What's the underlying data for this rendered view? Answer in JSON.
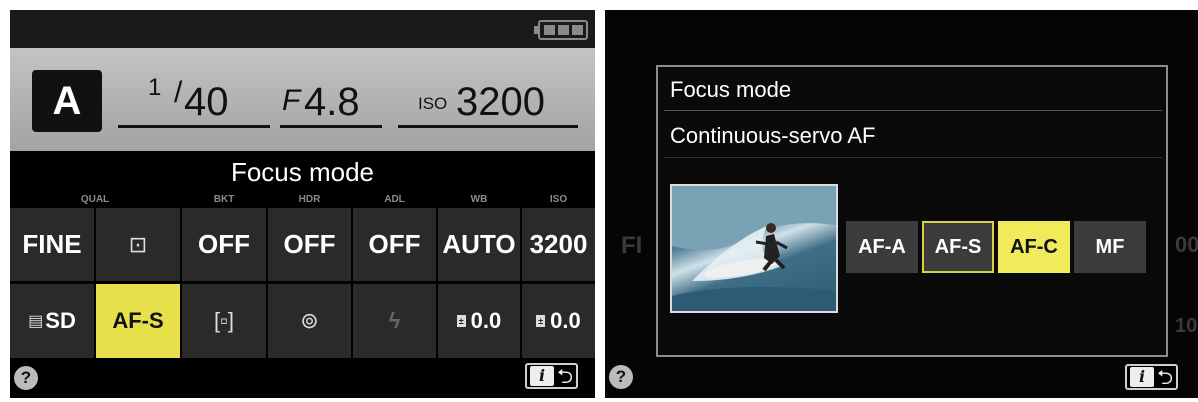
{
  "left_screen": {
    "mode": "A",
    "shutter": {
      "numerator": "1",
      "denominator": "40"
    },
    "aperture": {
      "prefix": "F",
      "value": "4.8"
    },
    "iso": {
      "label": "ISO",
      "value": "3200"
    },
    "title": "Focus mode",
    "column_labels": [
      "QUAL",
      "BKT",
      "HDR",
      "ADL",
      "WB",
      "ISO"
    ],
    "row1": [
      "FINE",
      "OFF",
      "OFF",
      "OFF",
      "AUTO",
      "3200"
    ],
    "row2": {
      "card": "SD",
      "focus_mode": "AF-S",
      "ev1": "0.0",
      "ev2": "0.0"
    },
    "help_label": "?",
    "info_label": "i",
    "active_color": "#e8e04a"
  },
  "right_screen": {
    "dialog_title": "Focus mode",
    "dialog_subtitle": "Continuous-servo AF",
    "options": [
      "AF-A",
      "AF-S",
      "AF-C",
      "MF"
    ],
    "selected_option": "AF-C",
    "highlighted_option": "AF-S",
    "ghost_left": "FI",
    "ghost_right": "00",
    "ghost_right2": "10",
    "help_label": "?",
    "info_label": "i",
    "selected_color": "#f1ea5a"
  }
}
